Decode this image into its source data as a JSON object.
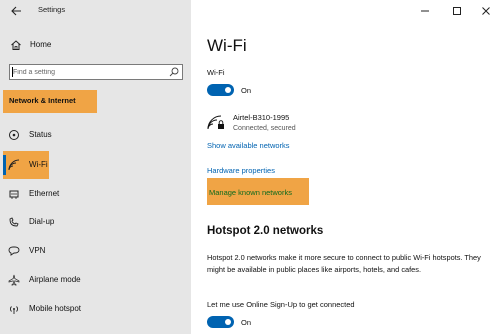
{
  "window": {
    "title": "Settings",
    "controls": [
      "minimize",
      "maximize",
      "close"
    ]
  },
  "sidebar": {
    "home_label": "Home",
    "search": {
      "placeholder": "Find a setting"
    },
    "section_label": "Network & Internet",
    "items": [
      {
        "label": "Status",
        "icon": "status-icon"
      },
      {
        "label": "Wi-Fi",
        "icon": "wifi-icon",
        "selected": true
      },
      {
        "label": "Ethernet",
        "icon": "ethernet-icon"
      },
      {
        "label": "Dial-up",
        "icon": "dialup-icon"
      },
      {
        "label": "VPN",
        "icon": "vpn-icon"
      },
      {
        "label": "Airplane mode",
        "icon": "airplane-icon"
      },
      {
        "label": "Mobile hotspot",
        "icon": "hotspot-icon"
      }
    ]
  },
  "main": {
    "title": "Wi-Fi",
    "wifi_toggle": {
      "label": "Wi-Fi",
      "state": "On"
    },
    "network": {
      "name": "Airtel-B310-1995",
      "status": "Connected, secured"
    },
    "links": {
      "show_networks": "Show available networks",
      "hardware": "Hardware properties",
      "manage": "Manage known networks"
    },
    "hotspot": {
      "title": "Hotspot 2.0 networks",
      "description": "Hotspot 2.0 networks make it more secure to connect to public Wi-Fi hotspots. They might be available in public places like airports, hotels, and cafes.",
      "osu_label": "Let me use Online Sign-Up to get connected",
      "osu_state": "On"
    }
  },
  "colors": {
    "accent": "#0063b1",
    "highlight": "#f0a445",
    "sidebar_bg": "#e6e6e6"
  }
}
